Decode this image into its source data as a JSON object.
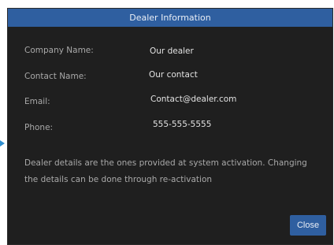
{
  "dialog": {
    "title": "Dealer Information",
    "fields": [
      {
        "label": "Company Name:",
        "value": "Our dealer"
      },
      {
        "label": "Contact Name:",
        "value": "Our contact"
      },
      {
        "label": "Email:",
        "value": "Contact@dealer.com"
      },
      {
        "label": "Phone:",
        "value": "555-555-5555"
      }
    ],
    "note": "Dealer details are the ones provided at system activation. Changing the details can be done through re-activation",
    "close_label": "Close"
  },
  "colors": {
    "titlebar": "#2f5fa0",
    "dialog_background": "#1f1f1f",
    "button": "#2f5fa0"
  }
}
